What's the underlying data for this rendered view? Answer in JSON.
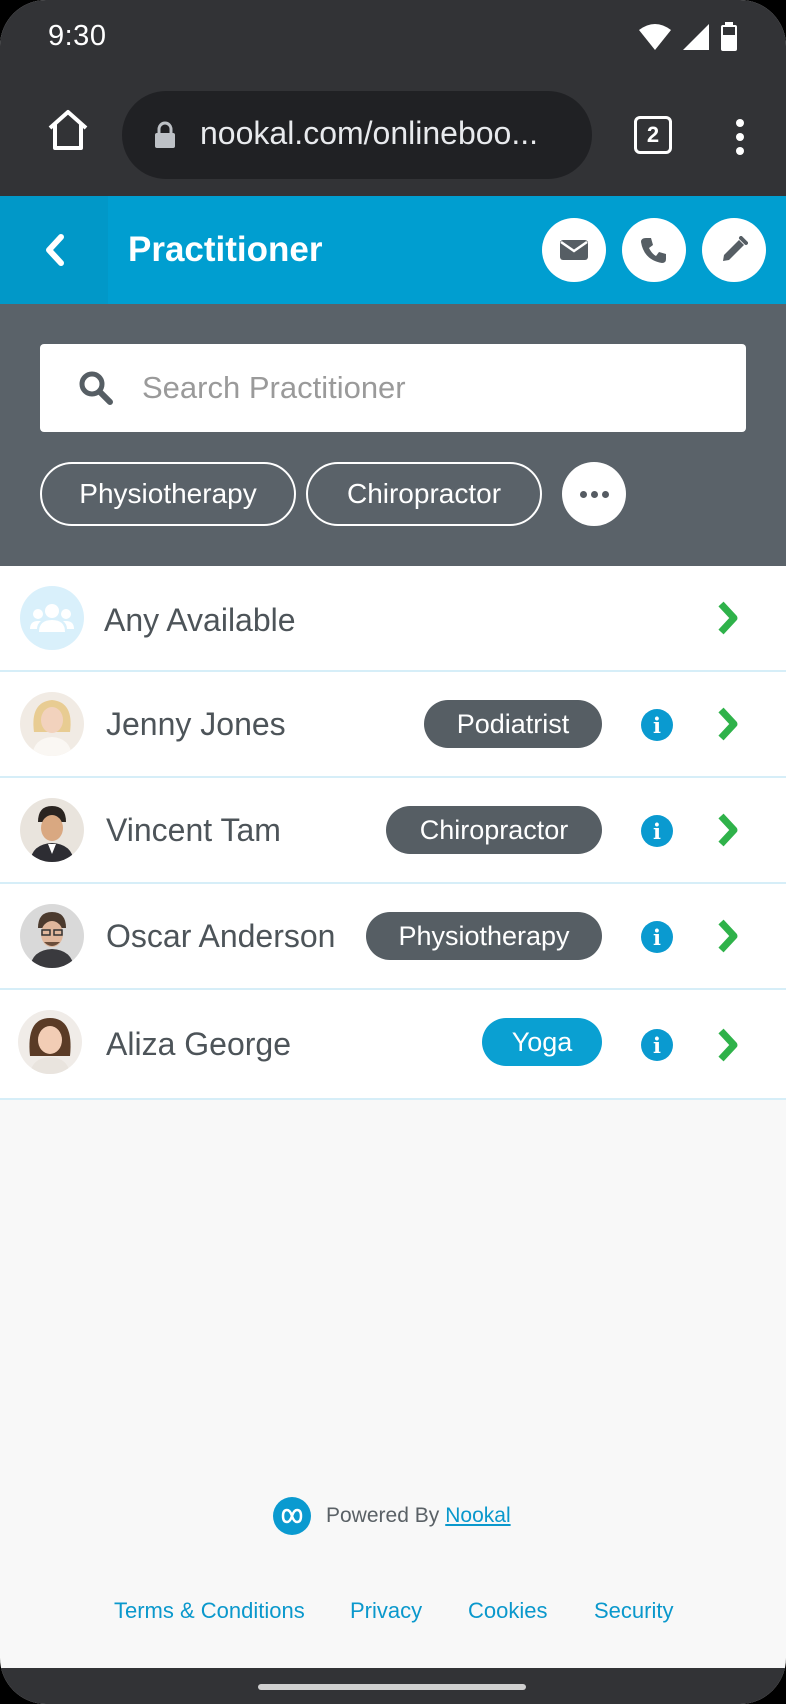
{
  "status_bar": {
    "time": "9:30"
  },
  "browser": {
    "url": "nookal.com/onlineboo...",
    "tab_count": "2"
  },
  "header": {
    "title": "Practitioner"
  },
  "search": {
    "placeholder": "Search Practitioner"
  },
  "filters": [
    {
      "label": "Physiotherapy"
    },
    {
      "label": "Chiropractor"
    }
  ],
  "list": {
    "any": {
      "label": "Any Available"
    },
    "practitioners": [
      {
        "name": "Jenny Jones",
        "specialty": "Podiatrist"
      },
      {
        "name": "Vincent Tam",
        "specialty": "Chiropractor"
      },
      {
        "name": "Oscar Anderson",
        "specialty": "Physiotherapy"
      },
      {
        "name": "Aliza George",
        "specialty": "Yoga"
      }
    ]
  },
  "footer": {
    "powered_prefix": "Powered By",
    "powered_link": "Nookal",
    "links": [
      "Terms & Conditions",
      "Privacy",
      "Cookies",
      "Security"
    ]
  },
  "colors": {
    "brand_blue": "#009ed0",
    "chevron_green": "#2fb24a",
    "badge_gray": "#565e64",
    "yoga_badge": "#0aa0d2"
  }
}
